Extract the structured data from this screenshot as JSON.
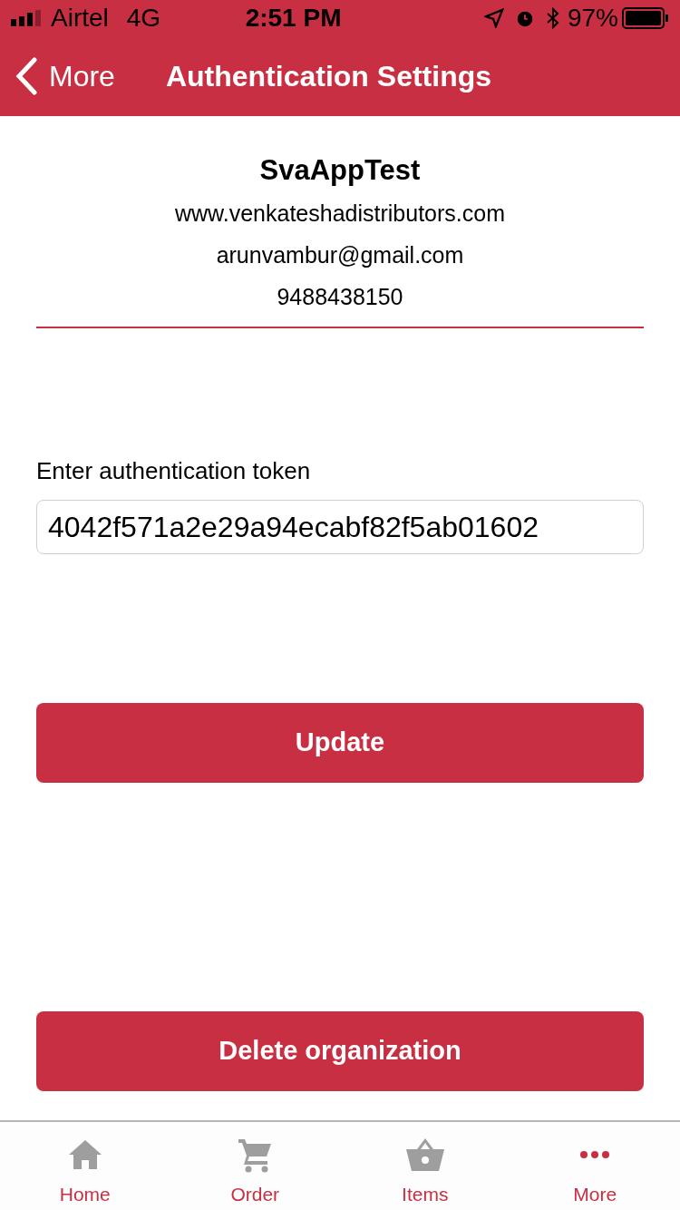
{
  "status_bar": {
    "carrier": "Airtel",
    "network": "4G",
    "time": "2:51 PM",
    "battery": "97%"
  },
  "nav": {
    "back": "More",
    "title": "Authentication Settings"
  },
  "organization": {
    "name": "SvaAppTest",
    "website": "www.venkateshadistributors.com",
    "email": "arunvambur@gmail.com",
    "phone": "9488438150"
  },
  "token": {
    "label": "Enter authentication token",
    "value": "4042f571a2e29a94ecabf82f5ab01602"
  },
  "buttons": [
    {
      "label": "Update"
    },
    {
      "label": "Delete organization"
    }
  ],
  "tabs": [
    {
      "label": "Home",
      "kind": "home",
      "selected": false
    },
    {
      "label": "Order",
      "kind": "cart",
      "selected": false
    },
    {
      "label": "Items",
      "kind": "basket",
      "selected": false
    },
    {
      "label": "More",
      "kind": "more",
      "selected": true
    }
  ]
}
